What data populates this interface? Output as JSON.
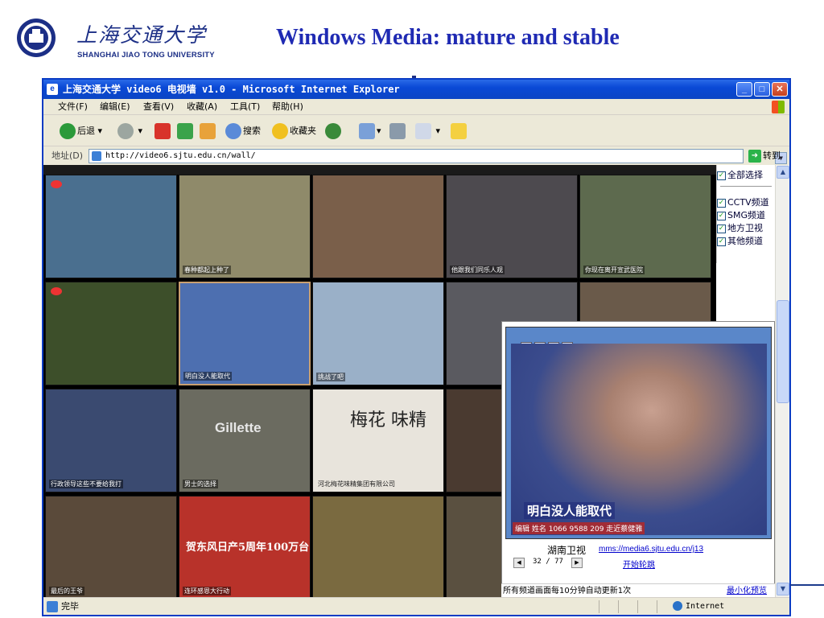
{
  "slide": {
    "title": "Windows Media: mature and stable",
    "university_cn": "上海交通大学",
    "university_en": "SHANGHAI JIAO TONG UNIVERSITY"
  },
  "window": {
    "title": "上海交通大学 video6 电视墙 v1.0 - Microsoft Internet Explorer",
    "controls": [
      "_",
      "□",
      "✕"
    ]
  },
  "menus": [
    "文件(F)",
    "编辑(E)",
    "查看(V)",
    "收藏(A)",
    "工具(T)",
    "帮助(H)"
  ],
  "toolbar": {
    "back": "后退",
    "search": "搜索",
    "favorites": "收藏夹"
  },
  "address": {
    "label": "地址(D)",
    "url": "http://video6.sjtu.edu.cn/wall/",
    "go": "转到"
  },
  "filters": [
    {
      "label": "全部选择",
      "checked": true
    },
    {
      "label": "CCTV频道",
      "checked": true
    },
    {
      "label": "SMG频道",
      "checked": true
    },
    {
      "label": "地方卫视",
      "checked": true
    },
    {
      "label": "其他频道",
      "checked": true
    }
  ],
  "thumbnails": [
    {
      "caption": "",
      "color": "#4a6f8f"
    },
    {
      "caption": "春种都起上种了",
      "color": "#8f8a6a"
    },
    {
      "caption": "",
      "color": "#7a5f4a"
    },
    {
      "caption": "他跟我们同乐人观",
      "color": "#4d4a4f"
    },
    {
      "caption": "你现在离开宣武医院",
      "color": "#5d6a4e"
    },
    {
      "caption": "",
      "color": "#3d4f2a"
    },
    {
      "caption": "明白没人能取代",
      "color": "#4d6fb0"
    },
    {
      "caption": "挑战了吧",
      "color": "#9ab0c8"
    },
    {
      "caption": "",
      "color": "#5a5a60"
    },
    {
      "caption": "",
      "color": "#6a5a4a"
    },
    {
      "caption": "行政领导这些不要给我打",
      "color": "#3a4a70"
    },
    {
      "caption": "男士的选择",
      "color": "#6b6b60"
    },
    {
      "caption": "河北梅花味精集团有限公司",
      "color": "#e8e4dc"
    },
    {
      "caption": "",
      "color": "#4a3a30"
    },
    {
      "caption": "",
      "color": "#2a2a2a"
    },
    {
      "caption": "最后的王爷",
      "color": "#5a4a3a"
    },
    {
      "caption": "连环感恩大行动",
      "color": "#b8322a"
    },
    {
      "caption": "",
      "color": "#7a6a40"
    },
    {
      "caption": "",
      "color": "#5a5040"
    },
    {
      "caption": "",
      "color": "#3a3a3a"
    }
  ],
  "overlay_texts": {
    "gillette": "Gillette",
    "meihua": "梅花 味精",
    "promo_big": "贺东风日产5周年100万台"
  },
  "preview": {
    "channel": "湖南卫视",
    "link": "mms://media6.sjtu.edu.cn/j13",
    "counter": "32 / 77",
    "autoplay": "开始轮跳",
    "caption": "明白没人能取代",
    "subcaption": "编辑 姓名 1066 9588 209 走近蔡健雅"
  },
  "notice": {
    "text": "所有频道画面每10分钟自动更新1次",
    "minimize": "最小化预览"
  },
  "status": {
    "text": "完毕",
    "zone": "Internet"
  }
}
